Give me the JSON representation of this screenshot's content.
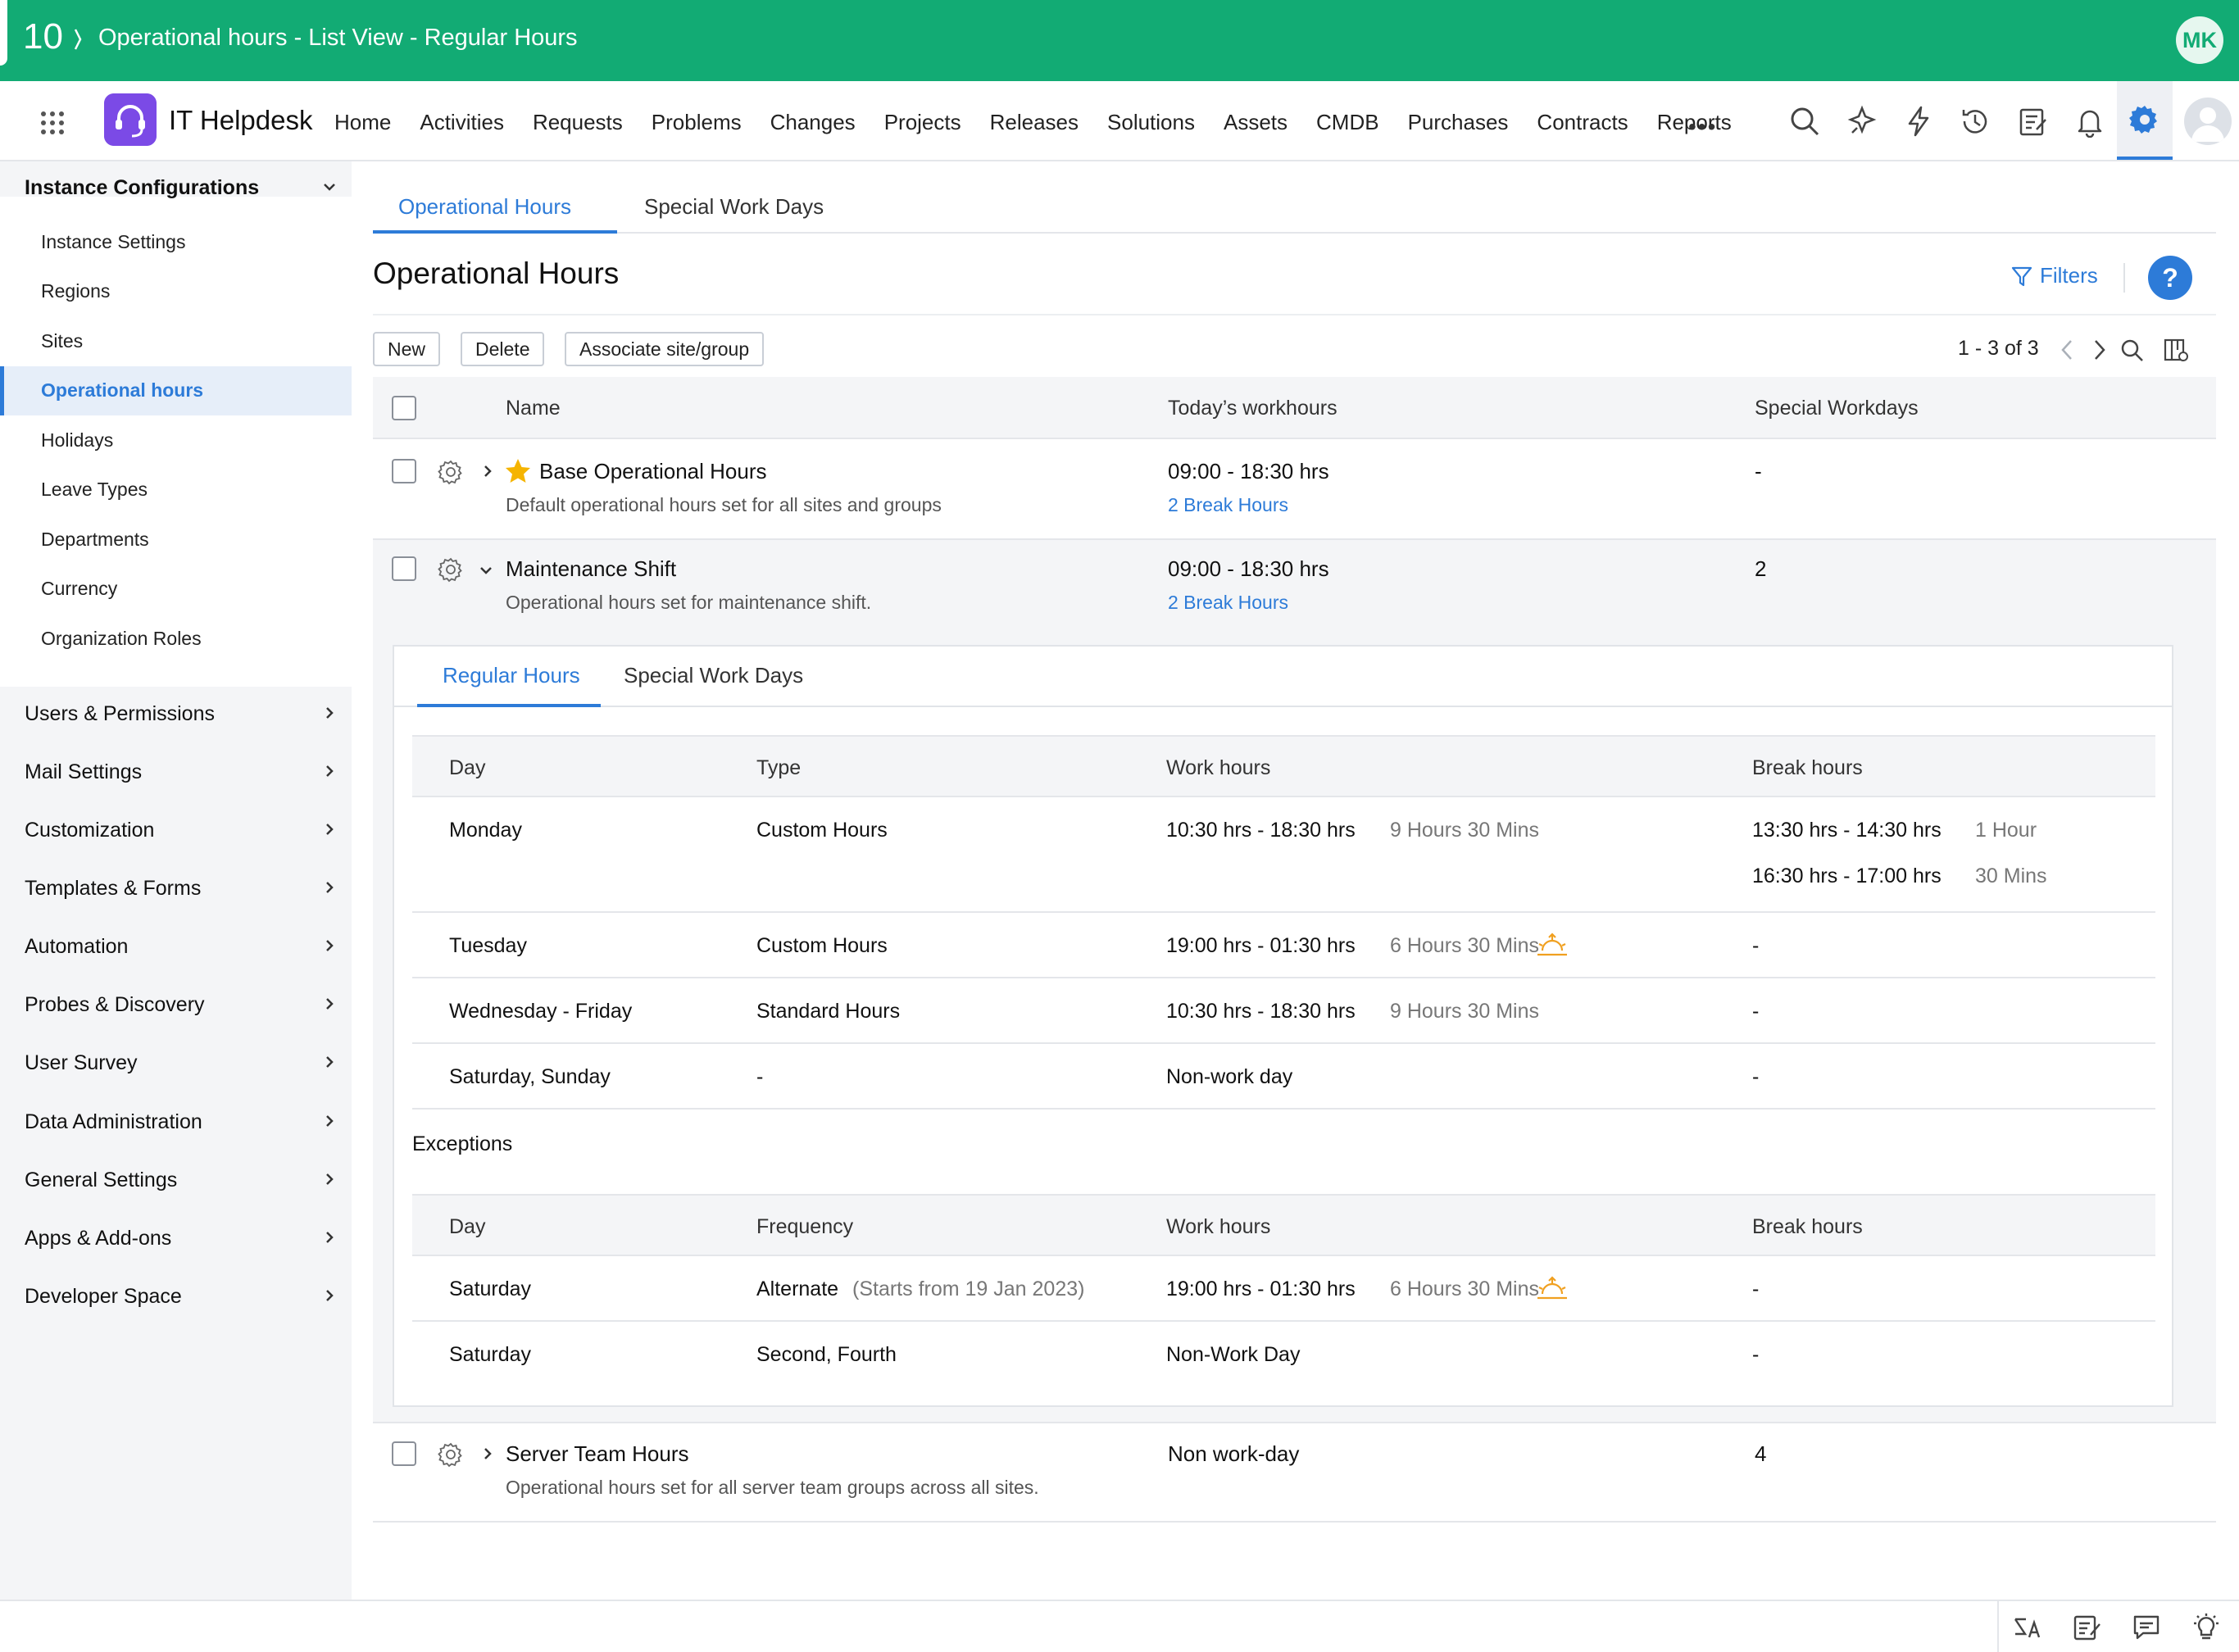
{
  "topbar": {
    "count": "10",
    "title": "Operational hours - List View - Regular Hours",
    "avatar_initials": "MK",
    "color": "#12ab74"
  },
  "navbar": {
    "brand": "IT Helpdesk",
    "menu": [
      "Home",
      "Activities",
      "Requests",
      "Problems",
      "Changes",
      "Projects",
      "Releases",
      "Solutions",
      "Assets",
      "CMDB",
      "Purchases",
      "Contracts",
      "Reports"
    ],
    "more": "•••",
    "icons": [
      "search-icon",
      "magic-icon",
      "lightning-icon",
      "history-icon",
      "notes-icon",
      "bell-icon",
      "gear-icon",
      "user-avatar-icon"
    ]
  },
  "sidebar": {
    "header": "Instance Configurations",
    "sub_items": [
      "Instance Settings",
      "Regions",
      "Sites",
      "Operational hours",
      "Holidays",
      "Leave Types",
      "Departments",
      "Currency",
      "Organization Roles"
    ],
    "active_item": "Operational hours",
    "groups": [
      "Users & Permissions",
      "Mail Settings",
      "Customization",
      "Templates & Forms",
      "Automation",
      "Probes & Discovery",
      "User Survey",
      "Data Administration",
      "General Settings",
      "Apps & Add-ons",
      "Developer Space"
    ]
  },
  "main": {
    "tabs": [
      "Operational Hours",
      "Special Work Days"
    ],
    "title": "Operational Hours",
    "filters": "Filters",
    "help": "?",
    "buttons": {
      "new": "New",
      "delete": "Delete",
      "associate": "Associate site/group"
    },
    "pager": "1 - 3 of 3",
    "columns": {
      "name": "Name",
      "today": "Today’s workhours",
      "special": "Special Workdays"
    },
    "rows": [
      {
        "name": "Base Operational Hours",
        "desc": "Default operational hours set for all sites and groups",
        "hours": "09:00 - 18:30 hrs",
        "break": "2 Break Hours",
        "special": "-"
      },
      {
        "name": "Maintenance Shift",
        "desc": "Operational hours set for maintenance shift.",
        "hours": "09:00 - 18:30 hrs",
        "break": "2 Break Hours",
        "special": "2"
      },
      {
        "name": "Server Team Hours",
        "desc": "Operational hours set for all server team groups across all sites.",
        "hours": "Non work-day",
        "special": "4"
      }
    ]
  },
  "detail": {
    "tabs": [
      "Regular Hours",
      "Special Work Days"
    ],
    "regular_cols": {
      "day": "Day",
      "type": "Type",
      "work": "Work hours",
      "break": "Break hours"
    },
    "regular_rows": [
      {
        "day": "Monday",
        "type": "Custom Hours",
        "work": "10:30 hrs - 18:30 hrs",
        "dur": "9 Hours 30 Mins",
        "break1": "13:30 hrs - 14:30 hrs",
        "break1_dur": "1 Hour",
        "break2": "16:30 hrs - 17:00 hrs",
        "break2_dur": "30 Mins"
      },
      {
        "day": "Tuesday",
        "type": "Custom Hours",
        "work": "19:00 hrs - 01:30 hrs",
        "dur": "6 Hours 30 Mins",
        "break1": "-"
      },
      {
        "day": "Wednesday - Friday",
        "type": "Standard Hours",
        "work": "10:30 hrs - 18:30 hrs",
        "dur": "9 Hours 30 Mins",
        "break1": "-"
      },
      {
        "day": "Saturday, Sunday",
        "type": "-",
        "work": "Non-work day",
        "break1": "-"
      }
    ],
    "exceptions_label": "Exceptions",
    "exception_cols": {
      "day": "Day",
      "freq": "Frequency",
      "work": "Work hours",
      "break": "Break hours"
    },
    "exception_rows": [
      {
        "day": "Saturday",
        "freq": "Alternate",
        "freq_note": "(Starts from 19 Jan 2023)",
        "work": "19:00 hrs - 01:30 hrs",
        "dur": "6 Hours 30 Mins",
        "break": "-"
      },
      {
        "day": "Saturday",
        "freq": "Second, Fourth",
        "work": "Non-Work Day",
        "break": "-"
      }
    ]
  },
  "bottombar": {
    "icons": [
      "translate-icon",
      "notes-icon",
      "chat-icon",
      "bulb-icon"
    ]
  },
  "colors": {
    "accent": "#2d7bd8",
    "night_icon": "#f0a020",
    "star": "#f5b400"
  }
}
